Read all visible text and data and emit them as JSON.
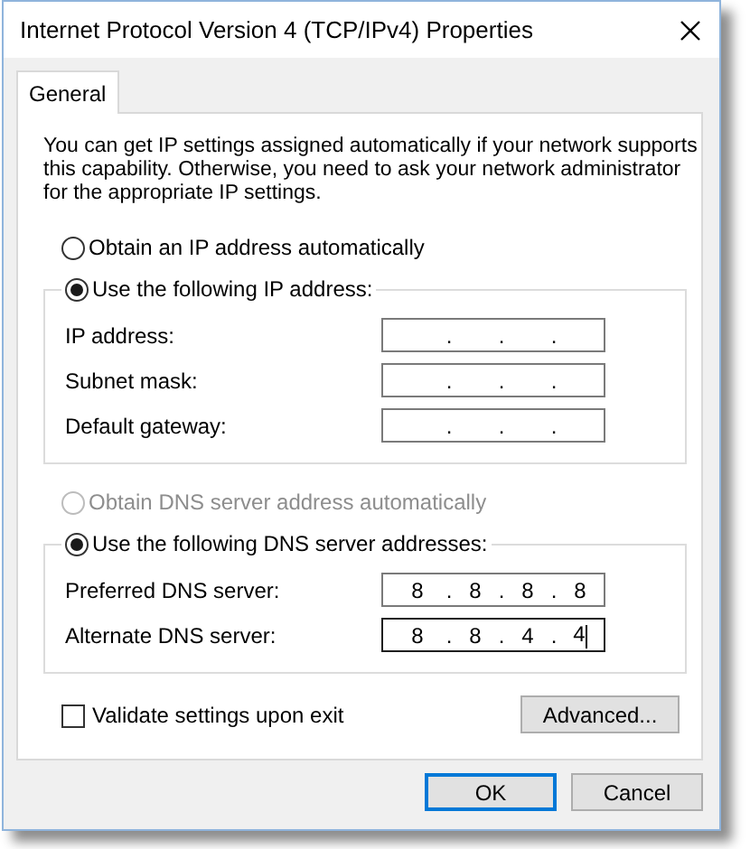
{
  "window": {
    "title": "Internet Protocol Version 4 (TCP/IPv4) Properties"
  },
  "tabs": [
    {
      "label": "General",
      "selected": true
    }
  ],
  "description": "You can get IP settings assigned automatically if your network supports this capability. Otherwise, you need to ask your network administrator for the appropriate IP settings.",
  "ip_mode": [
    {
      "label": "Obtain an IP address automatically",
      "selected": false,
      "disabled": false
    },
    {
      "label": "Use the following IP address:",
      "selected": true,
      "disabled": false,
      "fields": [
        {
          "label": "IP address:",
          "dots": [
            ".",
            ".",
            "."
          ],
          "focused": false
        },
        {
          "label": "Subnet mask:",
          "dots": [
            ".",
            ".",
            "."
          ],
          "focused": false
        },
        {
          "label": "Default gateway:",
          "dots": [
            ".",
            ".",
            "."
          ],
          "focused": false
        }
      ]
    }
  ],
  "dns_mode": [
    {
      "label": "Obtain DNS server address automatically",
      "selected": false,
      "disabled": true
    },
    {
      "label": "Use the following DNS server addresses:",
      "selected": true,
      "disabled": false,
      "fields": [
        {
          "label": "Preferred DNS server:",
          "octets": [
            "8",
            "8",
            "8",
            "8"
          ],
          "dots": [
            ".",
            ".",
            "."
          ],
          "focused": false
        },
        {
          "label": "Alternate DNS server:",
          "octets": [
            "8",
            "8",
            "4",
            "4"
          ],
          "dots": [
            ".",
            ".",
            "."
          ],
          "focused": true
        }
      ]
    }
  ],
  "validate": {
    "label": "Validate settings upon exit",
    "checked": false
  },
  "advanced_button": {
    "label": "Advanced...",
    "default": false
  },
  "buttons": [
    {
      "label": "OK",
      "default": true
    },
    {
      "label": "Cancel",
      "default": false
    }
  ]
}
